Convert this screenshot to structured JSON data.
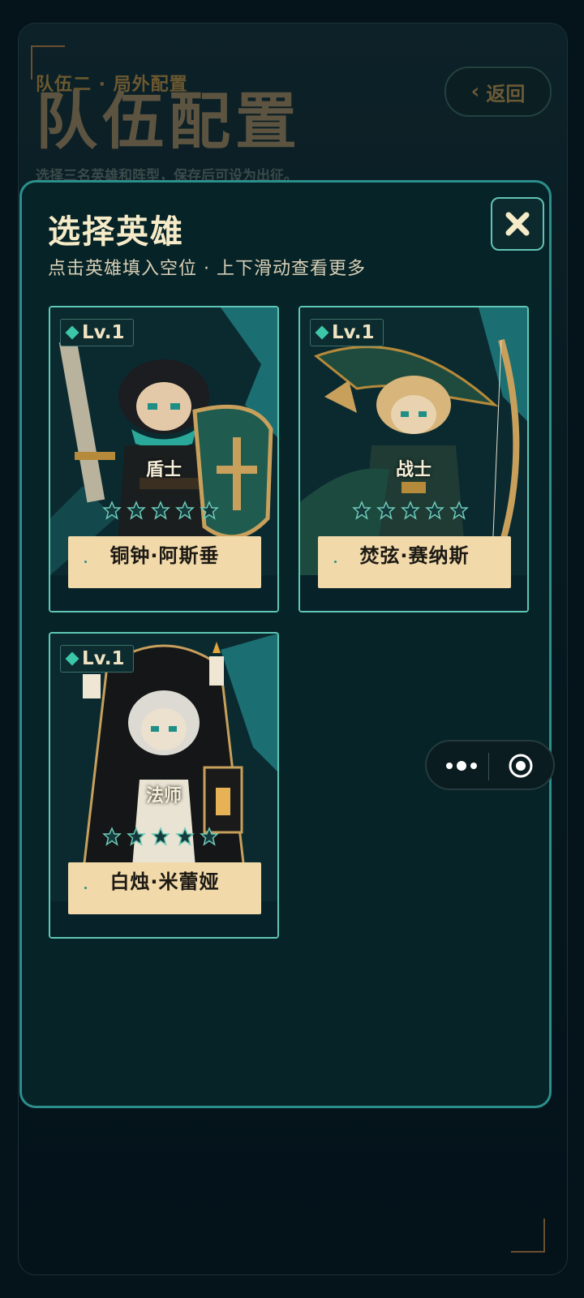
{
  "page": {
    "eyebrow": "队伍二 · 局外配置",
    "title": "队伍配置",
    "subtitle": "选择三名英雄和阵型，保存后可设为出征。",
    "back_label": "返回"
  },
  "modal": {
    "title": "选择英雄",
    "subtitle": "点击英雄填入空位 · 上下滑动查看更多",
    "close_icon": "close-icon"
  },
  "heroes": [
    {
      "level": "Lv.1",
      "role": "盾士",
      "name": "铜钟·阿斯垂",
      "stars": 5
    },
    {
      "level": "Lv.1",
      "role": "战士",
      "name": "焚弦·赛纳斯",
      "stars": 5
    },
    {
      "level": "Lv.1",
      "role": "法师",
      "name": "白烛·米蕾娅",
      "stars": 5
    }
  ],
  "capsule": {
    "more_icon": "more-dots-icon",
    "close_icon": "target-icon"
  },
  "colors": {
    "accent": "#2b8f8c",
    "name_bar": "#f1d9aa",
    "title": "#f6ebc8"
  }
}
